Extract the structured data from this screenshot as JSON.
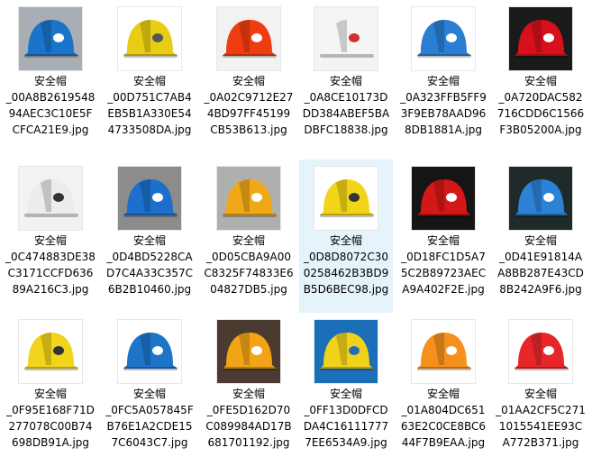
{
  "files": [
    {
      "line1": "安全帽",
      "line2": "_00A8B2619548",
      "line3": "94AEC3C10E5F",
      "line4": "CFCA21E9.jpg",
      "bg": "#a9aeb4",
      "shell": "#1a74c9",
      "logo": "#ffffff",
      "icon": "helmet-blue-icon",
      "selected": false
    },
    {
      "line1": "安全帽",
      "line2": "_00D751C7AB4",
      "line3": "EB5B1A330E54",
      "line4": "4733508DA.jpg",
      "bg": "#ffffff",
      "shell": "#e8cd14",
      "logo": "#555555",
      "icon": "helmet-yellow-icon",
      "selected": false
    },
    {
      "line1": "安全帽",
      "line2": "_0A02C9712E27",
      "line3": "4BD97FF45199",
      "line4": "CB53B613.jpg",
      "bg": "#f2f2f2",
      "shell": "#ef3c10",
      "logo": "#ffffff",
      "icon": "helmet-orange-red-icon",
      "selected": false
    },
    {
      "line1": "安全帽",
      "line2": "_0A8CE10173D",
      "line3": "DD384ABEF5BA",
      "line4": "DBFC18838.jpg",
      "bg": "#f4f4f4",
      "shell": "#f5f5f5",
      "logo": "#d03030",
      "icon": "helmet-white-icon",
      "selected": false
    },
    {
      "line1": "安全帽",
      "line2": "_0A323FFB5FF9",
      "line3": "3F9EB78AAD96",
      "line4": "8DB1881A.jpg",
      "bg": "#ffffff",
      "shell": "#2a7fd4",
      "logo": "#ffffff",
      "icon": "helmet-blue-icon",
      "selected": false
    },
    {
      "line1": "安全帽",
      "line2": "_0A720DAC582",
      "line3": "716CDD6C1566",
      "line4": "F3B05200A.jpg",
      "bg": "#1a1a1a",
      "shell": "#d8101c",
      "logo": "#ffffff",
      "icon": "helmet-red-icon",
      "selected": false
    },
    {
      "line1": "安全帽",
      "line2": "_0C474883DE38",
      "line3": "C3171CCFD636",
      "line4": "89A216C3.jpg",
      "bg": "#f2f2f2",
      "shell": "#ececec",
      "logo": "#333333",
      "icon": "helmet-white-icon",
      "selected": false
    },
    {
      "line1": "安全帽",
      "line2": "_0D4BD5228CA",
      "line3": "D7C4A33C357C",
      "line4": "6B2B10460.jpg",
      "bg": "#8c8c8c",
      "shell": "#1c6fcb",
      "logo": "#ffffff",
      "icon": "helmet-blue-icon",
      "selected": false
    },
    {
      "line1": "安全帽",
      "line2": "_0D05CBA9A00",
      "line3": "C8325F74833E6",
      "line4": "04827DB5.jpg",
      "bg": "#aeb0ae",
      "shell": "#f0a818",
      "logo": "#ffffff",
      "icon": "helmet-orange-icon",
      "selected": false
    },
    {
      "line1": "安全帽",
      "line2": "_0D8D8072C30",
      "line3": "0258462B3BD9",
      "line4": "B5D6BEC98.jpg",
      "bg": "#ffffff",
      "shell": "#f2d418",
      "logo": "#333333",
      "icon": "helmet-yellow-icon",
      "selected": true
    },
    {
      "line1": "安全帽",
      "line2": "_0D18FC1D5A7",
      "line3": "5C2B89723AEC",
      "line4": "A9A402F2E.jpg",
      "bg": "#151515",
      "shell": "#d41818",
      "logo": "#ffffff",
      "icon": "helmet-red-icon",
      "selected": false
    },
    {
      "line1": "安全帽",
      "line2": "_0D41E91814A",
      "line3": "A8BB287E43CD",
      "line4": "8B242A9F6.jpg",
      "bg": "#1f2a2a",
      "shell": "#2b82d6",
      "logo": "#ffffff",
      "icon": "helmet-blue-icon",
      "selected": false
    },
    {
      "line1": "安全帽",
      "line2": "_0F95E168F71D",
      "line3": "277078C00B74",
      "line4": "698DB91A.jpg",
      "bg": "#ffffff",
      "shell": "#f2d41c",
      "logo": "#333333",
      "icon": "helmet-yellow-icon",
      "selected": false
    },
    {
      "line1": "安全帽",
      "line2": "_0FC5A057845F",
      "line3": "B76E1A2CDE15",
      "line4": "7C6043C7.jpg",
      "bg": "#ffffff",
      "shell": "#1d74c8",
      "logo": "#ffffff",
      "icon": "helmet-blue-icon",
      "selected": false
    },
    {
      "line1": "安全帽",
      "line2": "_0FE5D162D70",
      "line3": "C089984AD17B",
      "line4": "681701192.jpg",
      "bg": "#4a3a30",
      "shell": "#f2a416",
      "logo": "#ffffff",
      "icon": "helmet-orange-icon",
      "selected": false
    },
    {
      "line1": "安全帽",
      "line2": "_0FF13D0DFCD",
      "line3": "DA4C16111777",
      "line4": "7EE6534A9.jpg",
      "bg": "#1b6fb8",
      "shell": "#f0d21a",
      "logo": "#1d6fb8",
      "icon": "helmet-yellow-icon",
      "selected": false
    },
    {
      "line1": "安全帽",
      "line2": "_01A804DC651",
      "line3": "63E2C0CE8BC6",
      "line4": "44F7B9EAA.jpg",
      "bg": "#ffffff",
      "shell": "#f5901c",
      "logo": "#ffffff",
      "icon": "helmet-orange-icon",
      "selected": false
    },
    {
      "line1": "安全帽",
      "line2": "_01AA2CF5C271",
      "line3": "1015541EE93C",
      "line4": "A772B371.jpg",
      "bg": "#ffffff",
      "shell": "#e8262a",
      "logo": "#ffffff",
      "icon": "helmet-red-icon",
      "selected": false
    }
  ]
}
